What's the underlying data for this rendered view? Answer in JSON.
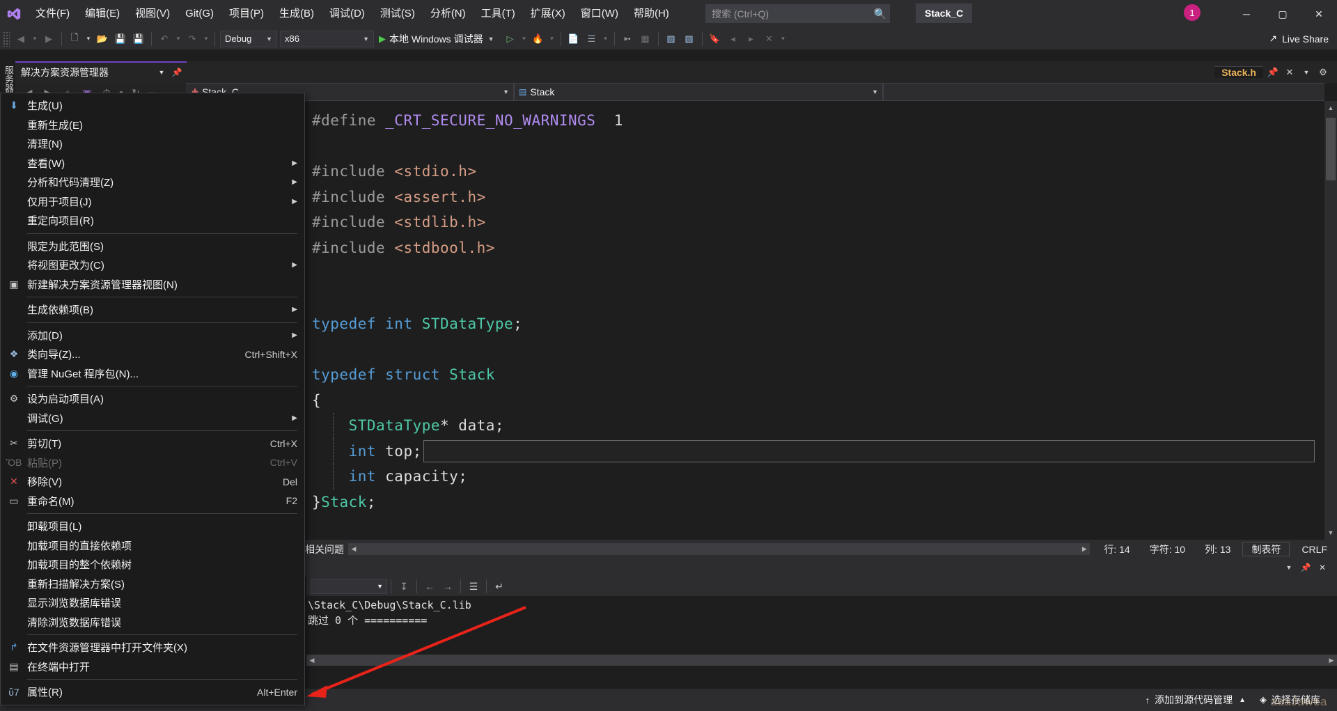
{
  "app": {
    "title": "Stack_C",
    "logo_icon": "visual-studio-logo"
  },
  "menubar": {
    "items": [
      {
        "label": "文件(F)",
        "name": "menu-file"
      },
      {
        "label": "编辑(E)",
        "name": "menu-edit"
      },
      {
        "label": "视图(V)",
        "name": "menu-view"
      },
      {
        "label": "Git(G)",
        "name": "menu-git"
      },
      {
        "label": "项目(P)",
        "name": "menu-project"
      },
      {
        "label": "生成(B)",
        "name": "menu-build"
      },
      {
        "label": "调试(D)",
        "name": "menu-debug"
      },
      {
        "label": "测试(S)",
        "name": "menu-test"
      },
      {
        "label": "分析(N)",
        "name": "menu-analyze"
      },
      {
        "label": "工具(T)",
        "name": "menu-tools"
      },
      {
        "label": "扩展(X)",
        "name": "menu-extensions"
      },
      {
        "label": "窗口(W)",
        "name": "menu-window"
      },
      {
        "label": "帮助(H)",
        "name": "menu-help"
      }
    ]
  },
  "search": {
    "placeholder": "搜索 (Ctrl+Q)",
    "value": "",
    "icon": "search-icon"
  },
  "project_chip": {
    "label": "Stack_C"
  },
  "notification": {
    "count": "1"
  },
  "window_controls": {
    "minimize": "─",
    "maximize": "▢",
    "close": "✕"
  },
  "toolbar": {
    "back_icon": "back-arrow-icon",
    "forward_icon": "forward-arrow-icon",
    "new_icon": "new-project-icon",
    "open_icon": "open-file-icon",
    "save_icon": "save-icon",
    "save_all_icon": "save-all-icon",
    "undo_icon": "undo-icon",
    "redo_icon": "redo-icon",
    "configuration": "Debug",
    "platform": "x86",
    "run_label": "本地 Windows 调试器",
    "live_share": "Live Share",
    "live_share_icon": "live-share-icon"
  },
  "vertical_tabs": {
    "label": "服务器资源管理器"
  },
  "solution_explorer": {
    "title": "解决方案资源管理器",
    "dropdown_icon": "chevron-down-icon",
    "pin_icon": "pin-icon",
    "close_icon": "close-icon",
    "tools": [
      "back-arrow-icon",
      "forward-arrow-icon",
      "home-icon",
      "solution-view-icon",
      "pending-changes-icon",
      "refresh-icon",
      "overflow-icon"
    ]
  },
  "editor": {
    "tabs": [
      {
        "label": "Stack.h",
        "active": true,
        "icon": "file-header-icon"
      }
    ],
    "tab_buttons": [
      "pin-icon",
      "close-icon",
      "chevron-down-icon",
      "gear-icon"
    ],
    "nav_project": "Stack_C",
    "nav_project_icon": "cpp-project-icon",
    "nav_symbol": "Stack",
    "nav_symbol_icon": "struct-icon",
    "code_lines": [
      {
        "indent": 0,
        "fold": null,
        "tokens": [
          {
            "t": "#define ",
            "c": "pp"
          },
          {
            "t": "_CRT_SECURE_NO_WARNINGS",
            "c": "macro"
          },
          {
            "t": "  1",
            "c": "plain"
          }
        ]
      },
      {
        "indent": 0,
        "fold": null,
        "tokens": []
      },
      {
        "indent": 0,
        "fold": "minus",
        "tokens": [
          {
            "t": "#include ",
            "c": "pp"
          },
          {
            "t": "<stdio.h>",
            "c": "str"
          }
        ]
      },
      {
        "indent": 0,
        "fold": null,
        "bar": true,
        "tokens": [
          {
            "t": "#include ",
            "c": "pp"
          },
          {
            "t": "<assert.h>",
            "c": "str"
          }
        ]
      },
      {
        "indent": 0,
        "fold": null,
        "bar": true,
        "tokens": [
          {
            "t": "#include ",
            "c": "pp"
          },
          {
            "t": "<stdlib.h>",
            "c": "str"
          }
        ]
      },
      {
        "indent": 0,
        "fold": null,
        "bar": true,
        "tokens": [
          {
            "t": "#include ",
            "c": "pp"
          },
          {
            "t": "<stdbool.h>",
            "c": "str"
          }
        ]
      },
      {
        "indent": 0,
        "fold": null,
        "barend": true,
        "tokens": []
      },
      {
        "indent": 0,
        "fold": null,
        "tokens": []
      },
      {
        "indent": 0,
        "fold": null,
        "tokens": [
          {
            "t": "typedef ",
            "c": "kw"
          },
          {
            "t": "int ",
            "c": "kw"
          },
          {
            "t": "STDataType",
            "c": "type"
          },
          {
            "t": ";",
            "c": "punct"
          }
        ]
      },
      {
        "indent": 0,
        "fold": null,
        "tokens": []
      },
      {
        "indent": 0,
        "fold": "minus",
        "tokens": [
          {
            "t": "typedef ",
            "c": "kw"
          },
          {
            "t": "struct ",
            "c": "kw"
          },
          {
            "t": "Stack",
            "c": "type"
          }
        ]
      },
      {
        "indent": 0,
        "fold": null,
        "bar": true,
        "tokens": [
          {
            "t": "{",
            "c": "punct"
          }
        ]
      },
      {
        "indent": 0,
        "fold": null,
        "bar": true,
        "dash": true,
        "tokens": [
          {
            "t": "    STDataType",
            "c": "type"
          },
          {
            "t": "* data;",
            "c": "plain"
          }
        ]
      },
      {
        "indent": 0,
        "fold": null,
        "bar": true,
        "dash": true,
        "highlight": true,
        "tokens": [
          {
            "t": "    int ",
            "c": "kw"
          },
          {
            "t": "top;",
            "c": "plain"
          }
        ]
      },
      {
        "indent": 0,
        "fold": null,
        "bar": true,
        "dash": true,
        "tokens": [
          {
            "t": "    int ",
            "c": "kw"
          },
          {
            "t": "capacity;",
            "c": "plain"
          }
        ]
      },
      {
        "indent": 0,
        "fold": null,
        "barend": true,
        "tokens": [
          {
            "t": "}",
            "c": "punct"
          },
          {
            "t": "Stack",
            "c": "type"
          },
          {
            "t": ";",
            "c": "punct"
          }
        ]
      }
    ],
    "status": {
      "related_issues": "相关问题",
      "line_label": "行: 14",
      "char_label": "字符: 10",
      "col_label": "列: 13",
      "tabs_label": "制表符",
      "eol_label": "CRLF"
    }
  },
  "output_panel": {
    "toolbar_combo": "",
    "toolbar_icons": [
      "go-to-icon",
      "previous-icon",
      "next-icon",
      "clear-all-icon",
      "word-wrap-icon"
    ],
    "lines": [
      "\\Stack_C\\Debug\\Stack_C.lib",
      "跳过 0 个 =========="
    ],
    "panel_buttons": [
      "chevron-down-icon",
      "pin-icon",
      "close-icon"
    ]
  },
  "statusbar": {
    "source_control_label": "添加到源代码管理",
    "source_control_icon": "up-arrow-icon",
    "source_control_caret": "▲",
    "repo_label": "选择存储库",
    "repo_icon": "git-repo-icon",
    "watermark": "aaaJawea"
  },
  "context_menu": {
    "items": [
      {
        "label": "生成(U)",
        "icon": "build-icon",
        "shortcut": "",
        "submenu": false,
        "disabled": false,
        "sep_after": false
      },
      {
        "label": "重新生成(E)",
        "icon": "",
        "shortcut": "",
        "submenu": false,
        "disabled": false,
        "sep_after": false
      },
      {
        "label": "清理(N)",
        "icon": "",
        "shortcut": "",
        "submenu": false,
        "disabled": false,
        "sep_after": false
      },
      {
        "label": "查看(W)",
        "icon": "",
        "shortcut": "",
        "submenu": true,
        "disabled": false,
        "sep_after": false
      },
      {
        "label": "分析和代码清理(Z)",
        "icon": "",
        "shortcut": "",
        "submenu": true,
        "disabled": false,
        "sep_after": false
      },
      {
        "label": "仅用于项目(J)",
        "icon": "",
        "shortcut": "",
        "submenu": true,
        "disabled": false,
        "sep_after": false
      },
      {
        "label": "重定向项目(R)",
        "icon": "",
        "shortcut": "",
        "submenu": false,
        "disabled": false,
        "sep_after": true
      },
      {
        "label": "限定为此范围(S)",
        "icon": "",
        "shortcut": "",
        "submenu": false,
        "disabled": false,
        "sep_after": false
      },
      {
        "label": "将视图更改为(C)",
        "icon": "",
        "shortcut": "",
        "submenu": true,
        "disabled": false,
        "sep_after": false
      },
      {
        "label": "新建解决方案资源管理器视图(N)",
        "icon": "new-view-icon",
        "shortcut": "",
        "submenu": false,
        "disabled": false,
        "sep_after": true
      },
      {
        "label": "生成依赖项(B)",
        "icon": "",
        "shortcut": "",
        "submenu": true,
        "disabled": false,
        "sep_after": true
      },
      {
        "label": "添加(D)",
        "icon": "",
        "shortcut": "",
        "submenu": true,
        "disabled": false,
        "sep_after": false
      },
      {
        "label": "类向导(Z)...",
        "icon": "class-wizard-icon",
        "shortcut": "Ctrl+Shift+X",
        "submenu": false,
        "disabled": false,
        "sep_after": false
      },
      {
        "label": "管理 NuGet 程序包(N)...",
        "icon": "nuget-icon",
        "shortcut": "",
        "submenu": false,
        "disabled": false,
        "sep_after": true
      },
      {
        "label": "设为启动项目(A)",
        "icon": "gear-icon",
        "shortcut": "",
        "submenu": false,
        "disabled": false,
        "sep_after": false
      },
      {
        "label": "调试(G)",
        "icon": "",
        "shortcut": "",
        "submenu": true,
        "disabled": false,
        "sep_after": true
      },
      {
        "label": "剪切(T)",
        "icon": "scissors-icon",
        "shortcut": "Ctrl+X",
        "submenu": false,
        "disabled": false,
        "sep_after": false
      },
      {
        "label": "粘贴(P)",
        "icon": "clipboard-icon",
        "shortcut": "Ctrl+V",
        "submenu": false,
        "disabled": true,
        "sep_after": false
      },
      {
        "label": "移除(V)",
        "icon": "remove-x-icon",
        "shortcut": "Del",
        "submenu": false,
        "disabled": false,
        "sep_after": false
      },
      {
        "label": "重命名(M)",
        "icon": "rename-icon",
        "shortcut": "F2",
        "submenu": false,
        "disabled": false,
        "sep_after": true
      },
      {
        "label": "卸载项目(L)",
        "icon": "",
        "shortcut": "",
        "submenu": false,
        "disabled": false,
        "sep_after": false
      },
      {
        "label": "加载项目的直接依赖项",
        "icon": "",
        "shortcut": "",
        "submenu": false,
        "disabled": false,
        "sep_after": false
      },
      {
        "label": "加载项目的整个依赖树",
        "icon": "",
        "shortcut": "",
        "submenu": false,
        "disabled": false,
        "sep_after": false
      },
      {
        "label": "重新扫描解决方案(S)",
        "icon": "",
        "shortcut": "",
        "submenu": false,
        "disabled": false,
        "sep_after": false
      },
      {
        "label": "显示浏览数据库错误",
        "icon": "",
        "shortcut": "",
        "submenu": false,
        "disabled": false,
        "sep_after": false
      },
      {
        "label": "清除浏览数据库错误",
        "icon": "",
        "shortcut": "",
        "submenu": false,
        "disabled": false,
        "sep_after": true
      },
      {
        "label": "在文件资源管理器中打开文件夹(X)",
        "icon": "open-folder-icon",
        "shortcut": "",
        "submenu": false,
        "disabled": false,
        "sep_after": false
      },
      {
        "label": "在终端中打开",
        "icon": "terminal-icon",
        "shortcut": "",
        "submenu": false,
        "disabled": false,
        "sep_after": true
      },
      {
        "label": "属性(R)",
        "icon": "properties-icon",
        "shortcut": "Alt+Enter",
        "submenu": false,
        "disabled": false,
        "sep_after": false
      }
    ]
  },
  "colors": {
    "accent_purple": "#6f42c1",
    "chrome": "#2d2d30",
    "editor_bg": "#1e1e1e",
    "menu_bg": "#1b1b1c",
    "badge_pink": "#c9217f",
    "annotation_red": "#e8231a",
    "tab_active_text": "#e8b159"
  }
}
